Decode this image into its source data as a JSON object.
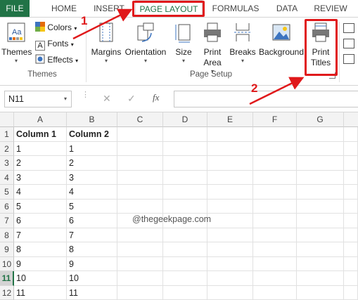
{
  "tabs": [
    {
      "label": "FILE",
      "name": "tab-file"
    },
    {
      "label": "HOME",
      "name": "tab-home"
    },
    {
      "label": "INSERT",
      "name": "tab-insert"
    },
    {
      "label": "PAGE LAYOUT",
      "name": "tab-page-layout"
    },
    {
      "label": "FORMULAS",
      "name": "tab-formulas"
    },
    {
      "label": "DATA",
      "name": "tab-data"
    },
    {
      "label": "REVIEW",
      "name": "tab-review"
    }
  ],
  "ribbon": {
    "themes_label": "Themes",
    "colors_label": "Colors",
    "fonts_label": "Fonts",
    "effects_label": "Effects",
    "themes_group": "Themes",
    "margins_label": "Margins",
    "orientation_label": "Orientation",
    "size_label": "Size",
    "print_area_line1": "Print",
    "print_area_line2": "Area",
    "breaks_label": "Breaks",
    "background_label": "Background",
    "print_titles_line1": "Print",
    "print_titles_line2": "Titles",
    "page_setup_group": "Page Setup"
  },
  "formula_bar": {
    "name_box": "N11",
    "fx_symbol": "fx",
    "cancel_symbol": "✕",
    "enter_symbol": "✓"
  },
  "columns": [
    "A",
    "B",
    "C",
    "D",
    "E",
    "F",
    "G"
  ],
  "rows": [
    {
      "n": "1",
      "a": "Column 1",
      "b": "Column 2"
    },
    {
      "n": "2",
      "a": "1",
      "b": "1"
    },
    {
      "n": "3",
      "a": "2",
      "b": "2"
    },
    {
      "n": "4",
      "a": "3",
      "b": "3"
    },
    {
      "n": "5",
      "a": "4",
      "b": "4"
    },
    {
      "n": "6",
      "a": "5",
      "b": "5"
    },
    {
      "n": "7",
      "a": "6",
      "b": "6"
    },
    {
      "n": "8",
      "a": "7",
      "b": "7"
    },
    {
      "n": "9",
      "a": "8",
      "b": "8"
    },
    {
      "n": "10",
      "a": "9",
      "b": "9"
    },
    {
      "n": "11",
      "a": "10",
      "b": "10"
    },
    {
      "n": "12",
      "a": "11",
      "b": "11"
    }
  ],
  "watermark": "@thegeekpage.com",
  "annotations": {
    "step1": "1",
    "step2": "2"
  },
  "colors": {
    "accent": "#217346",
    "highlight": "#e0191b"
  }
}
